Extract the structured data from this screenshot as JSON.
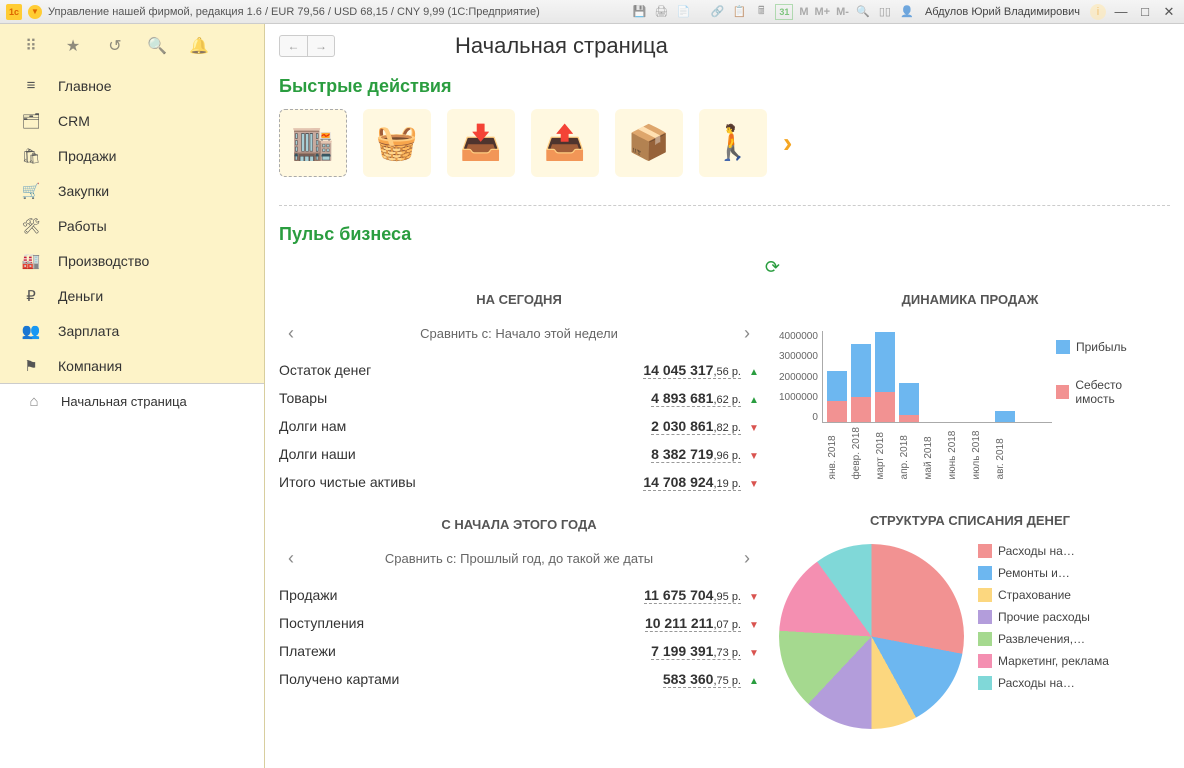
{
  "titlebar": {
    "title": "Управление нашей фирмой, редакция 1.6 / EUR 79,56 / USD 68,15 / CNY 9,99  (1С:Предприятие)",
    "user": "Абдулов Юрий Владимирович",
    "m": "M",
    "mplus": "M+",
    "mminus": "M-",
    "cal": "31"
  },
  "sidebar": {
    "items": [
      {
        "label": "Главное",
        "icon": "≡"
      },
      {
        "label": "CRM",
        "icon": "🗂"
      },
      {
        "label": "Продажи",
        "icon": "🛍"
      },
      {
        "label": "Закупки",
        "icon": "🛒"
      },
      {
        "label": "Работы",
        "icon": "🛠"
      },
      {
        "label": "Производство",
        "icon": "🏭"
      },
      {
        "label": "Деньги",
        "icon": "₽"
      },
      {
        "label": "Зарплата",
        "icon": "👥"
      },
      {
        "label": "Компания",
        "icon": "⚑"
      }
    ],
    "home": "Начальная страница"
  },
  "page": {
    "title": "Начальная страница"
  },
  "quick": {
    "title": "Быстрые действия"
  },
  "pulse": {
    "title": "Пульс бизнеса",
    "today_heading": "НА СЕГОДНЯ",
    "today_compare": "Сравнить с: Начало этой недели",
    "today_rows": [
      {
        "label": "Остаток денег",
        "int": "14 045 317",
        "frac": ",56 р.",
        "trend": "up"
      },
      {
        "label": "Товары",
        "int": "4 893 681",
        "frac": ",62 р.",
        "trend": "up"
      },
      {
        "label": "Долги нам",
        "int": "2 030 861",
        "frac": ",82 р.",
        "trend": "down"
      },
      {
        "label": "Долги наши",
        "int": "8 382 719",
        "frac": ",96 р.",
        "trend": "down"
      },
      {
        "label": "Итого чистые активы",
        "int": "14 708 924",
        "frac": ",19 р.",
        "trend": "down"
      }
    ],
    "ytd_heading": "С НАЧАЛА ЭТОГО ГОДА",
    "ytd_compare": "Сравнить с: Прошлый год, до такой же даты",
    "ytd_rows": [
      {
        "label": "Продажи",
        "int": "11 675 704",
        "frac": ",95 р.",
        "trend": "down"
      },
      {
        "label": "Поступления",
        "int": "10 211 211",
        "frac": ",07 р.",
        "trend": "down"
      },
      {
        "label": "Платежи",
        "int": "7 199 391",
        "frac": ",73 р.",
        "trend": "down"
      },
      {
        "label": "Получено картами",
        "int": "583 360",
        "frac": ",75 р.",
        "trend": "up"
      }
    ]
  },
  "chart_data": [
    {
      "type": "bar",
      "title": "ДИНАМИКА ПРОДАЖ",
      "categories": [
        "янв. 2018",
        "февр. 2018",
        "март 2018",
        "апр. 2018",
        "май 2018",
        "июнь 2018",
        "июль 2018",
        "авг. 2018"
      ],
      "series": [
        {
          "name": "Прибыль",
          "color": "#6db7f0",
          "values": [
            2200000,
            3400000,
            3900000,
            1700000,
            0,
            0,
            0,
            500000
          ]
        },
        {
          "name": "Себесто имость",
          "color": "#f29292",
          "values": [
            900000,
            1100000,
            1300000,
            300000,
            0,
            0,
            0,
            0
          ]
        }
      ],
      "ylim": [
        0,
        4000000
      ],
      "yticks": [
        "4000000",
        "3000000",
        "2000000",
        "1000000",
        "0"
      ]
    },
    {
      "type": "pie",
      "title": "СТРУКТУРА СПИСАНИЯ ДЕНЕГ",
      "slices": [
        {
          "name": "Расходы на…",
          "color": "#f29292",
          "value": 28
        },
        {
          "name": "Ремонты и…",
          "color": "#6db7f0",
          "value": 14
        },
        {
          "name": "Страхование",
          "color": "#fcd77f",
          "value": 8
        },
        {
          "name": "Прочие расходы",
          "color": "#b39ddb",
          "value": 12
        },
        {
          "name": "Развлечения,…",
          "color": "#a5d98f",
          "value": 14
        },
        {
          "name": "Маркетинг, реклама",
          "color": "#f48fb1",
          "value": 14
        },
        {
          "name": "Расходы на…",
          "color": "#80d8d8",
          "value": 10
        }
      ]
    }
  ]
}
